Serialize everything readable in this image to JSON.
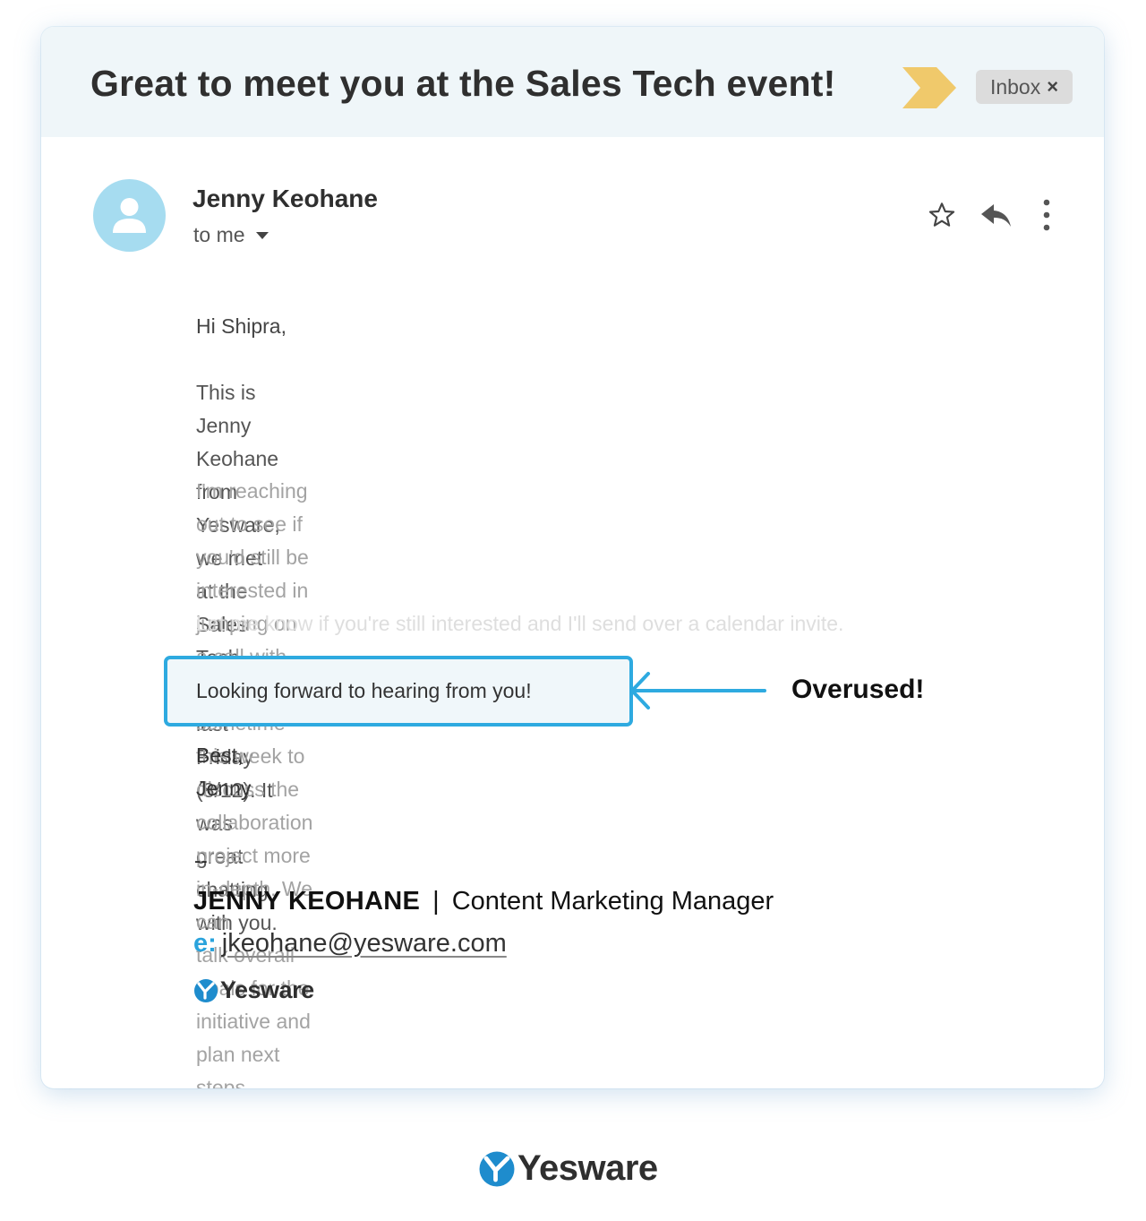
{
  "email": {
    "subject": "Great to meet you at the Sales Tech event!",
    "label_chip": "Inbox",
    "label_remove": "×",
    "sender_name": "Jenny Keohane",
    "recipient": "to me",
    "paragraphs": [
      "Hi Shipra,",
      "This is Jenny Keohane from Yesware, we met at the Sales Tech event last Friday\n(8/12). It was great chatting with you.",
      "I'm reaching out to see if you'd still be interested in jumping on a call with me\nsometime this week to discuss the collaboration project more in-depth. We can\ntalk overall goals for the initiative and plan next steps.",
      "Let me know if you're still interested and I'll send over a calendar invite."
    ],
    "highlighted_line": "Looking forward to hearing from you!",
    "signoff": "Best,\nJenny",
    "signature": {
      "separator": "--",
      "name": "JENNY KEOHANE",
      "divider": "|",
      "title": "Content Marketing Manager",
      "email_label": "e:",
      "email": "jkeohane@yesware.com",
      "logo_text": "Yesware"
    }
  },
  "annotation": {
    "label": "Overused!",
    "color": "#2eaae0"
  },
  "footer": {
    "logo_text": "Yesware"
  },
  "icons": {
    "importance": "importance-marker-icon",
    "star": "star-icon",
    "reply": "reply-icon",
    "more": "more-vertical-icon",
    "avatar": "person-icon"
  },
  "colors": {
    "accent_blue": "#2eaae0",
    "importance_yellow": "#f0c96b",
    "avatar_bg": "#a6dcf0",
    "header_bg": "#eff6f9"
  }
}
